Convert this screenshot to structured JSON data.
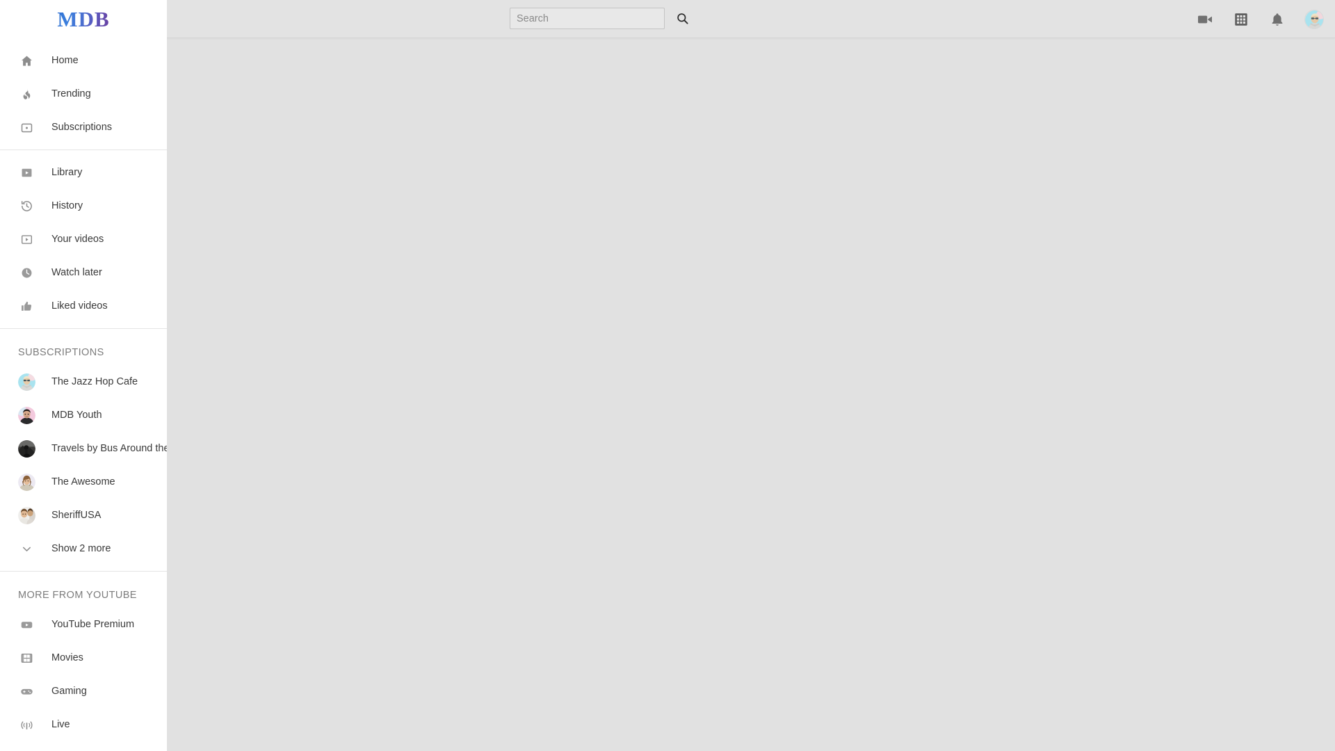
{
  "app": {
    "logo": "MDB",
    "brand_gradient_start": "#2f6fd0",
    "brand_gradient_end": "#6b3f9e"
  },
  "header": {
    "search": {
      "placeholder": "Search",
      "value": "",
      "button_icon": "search-icon"
    },
    "actions": [
      {
        "name": "create-video-icon",
        "label": "Create"
      },
      {
        "name": "apps-grid-icon",
        "label": "YouTube apps"
      },
      {
        "name": "notifications-bell-icon",
        "label": "Notifications"
      },
      {
        "name": "account-avatar",
        "label": "Account"
      }
    ]
  },
  "sidebar": {
    "primary": [
      {
        "icon": "home-icon",
        "label": "Home"
      },
      {
        "icon": "trending-flame-icon",
        "label": "Trending"
      },
      {
        "icon": "subscriptions-icon",
        "label": "Subscriptions"
      }
    ],
    "library": [
      {
        "icon": "library-icon",
        "label": "Library"
      },
      {
        "icon": "history-icon",
        "label": "History"
      },
      {
        "icon": "your-videos-icon",
        "label": "Your videos"
      },
      {
        "icon": "watch-later-clock-icon",
        "label": "Watch later"
      },
      {
        "icon": "liked-videos-thumbup-icon",
        "label": "Liked videos"
      }
    ],
    "subscriptions_title": "SUBSCRIPTIONS",
    "subscriptions": [
      {
        "name": "The Jazz Hop Cafe",
        "avatar": "jazz-hop-cafe-avatar"
      },
      {
        "name": "MDB Youth",
        "avatar": "mdb-youth-avatar"
      },
      {
        "name": "Travels by Bus Around the World",
        "avatar": "travels-by-bus-avatar"
      },
      {
        "name": "The Awesome",
        "avatar": "the-awesome-avatar"
      },
      {
        "name": "SheriffUSA",
        "avatar": "sheriffusa-avatar"
      }
    ],
    "show_more_label": "Show 2 more",
    "more_title": "MORE FROM YOUTUBE",
    "more": [
      {
        "icon": "youtube-premium-icon",
        "label": "YouTube Premium"
      },
      {
        "icon": "movies-icon",
        "label": "Movies"
      },
      {
        "icon": "gaming-controller-icon",
        "label": "Gaming"
      },
      {
        "icon": "live-broadcast-icon",
        "label": "Live"
      }
    ]
  },
  "main": {
    "content": "",
    "background": "#e1e1e1"
  }
}
